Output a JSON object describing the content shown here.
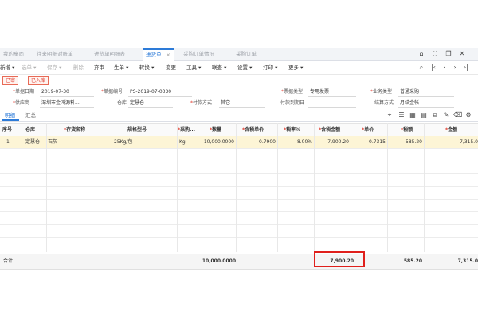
{
  "tabs": [
    {
      "label": "我的桌面"
    },
    {
      "label": "往来明细对账单"
    },
    {
      "label": "进货单明细表"
    },
    {
      "label": "进货单",
      "active": true
    },
    {
      "label": "采购订单情况"
    },
    {
      "label": "采购订单"
    }
  ],
  "tab_close": "×",
  "tab_icons": [
    "home-icon",
    "expand-icon",
    "restore-icon",
    "close-icon",
    "first-icon",
    "prev-icon",
    "next-icon",
    "last-icon"
  ],
  "toolbar": [
    {
      "label": "新增 ▾",
      "enabled": true
    },
    {
      "label": "选单 ▾",
      "enabled": false
    },
    {
      "label": "保存 ▾",
      "enabled": false
    },
    {
      "label": "删除",
      "enabled": false
    },
    {
      "label": "弃审",
      "enabled": true
    },
    {
      "label": "生单 ▾",
      "enabled": true
    },
    {
      "label": "转换 ▾",
      "enabled": true
    },
    {
      "label": "变更",
      "enabled": true
    },
    {
      "label": "工具 ▾",
      "enabled": true
    },
    {
      "label": "联查 ▾",
      "enabled": true
    },
    {
      "label": "设置 ▾",
      "enabled": true
    },
    {
      "label": "打印 ▾",
      "enabled": true
    },
    {
      "label": "更多 ▾",
      "enabled": true
    }
  ],
  "badges": [
    "已审",
    "已入库"
  ],
  "form": {
    "date_label": "单据日期",
    "date_value": "2019-07-30",
    "no_label": "单据编号",
    "no_value": "PS-2019-07-0330",
    "invoice_label": "票据类型",
    "invoice_value": "专用发票",
    "biz_label": "业务类型",
    "biz_value": "普通采购",
    "vendor_label": "供应商",
    "vendor_value": "深圳市金鸿源科...",
    "wh_label": "仓库",
    "wh_value": "定慧仓",
    "pay_label": "付款方式",
    "pay_value": "其它",
    "due_label": "付款到期日",
    "due_value": "",
    "settle_label": "结算方式",
    "settle_value": "月结金帐"
  },
  "subtabs": [
    "明细",
    "汇总"
  ],
  "grid": {
    "columns": [
      "序号",
      "仓库",
      "存货名称",
      "规格型号",
      "采购...",
      "数量",
      "含税单价",
      "税率%",
      "含税金额",
      "单价",
      "税额",
      "金额"
    ],
    "required": [
      false,
      false,
      true,
      false,
      true,
      true,
      true,
      true,
      true,
      true,
      true,
      true
    ],
    "rows": [
      [
        "1",
        "定慧仓",
        "石灰",
        "25Kg/包",
        "Kg",
        "10,000.0000",
        "0.7900",
        "8.00%",
        "7,900.20",
        "0.7315",
        "585.20",
        "7,315.0"
      ]
    ],
    "empty_rows": [
      "2",
      "3",
      "4",
      "5",
      "6",
      "7",
      "8",
      "9",
      "10"
    ]
  },
  "totals": {
    "label": "合计",
    "qty": "10,000.0000",
    "amount_tax": "7,900.20",
    "tax": "585.20",
    "amount": "7,315.0"
  },
  "colors": {
    "accent": "#2d7bd8",
    "highlight": "#e0201c",
    "selected_row": "#fdf5d6"
  }
}
